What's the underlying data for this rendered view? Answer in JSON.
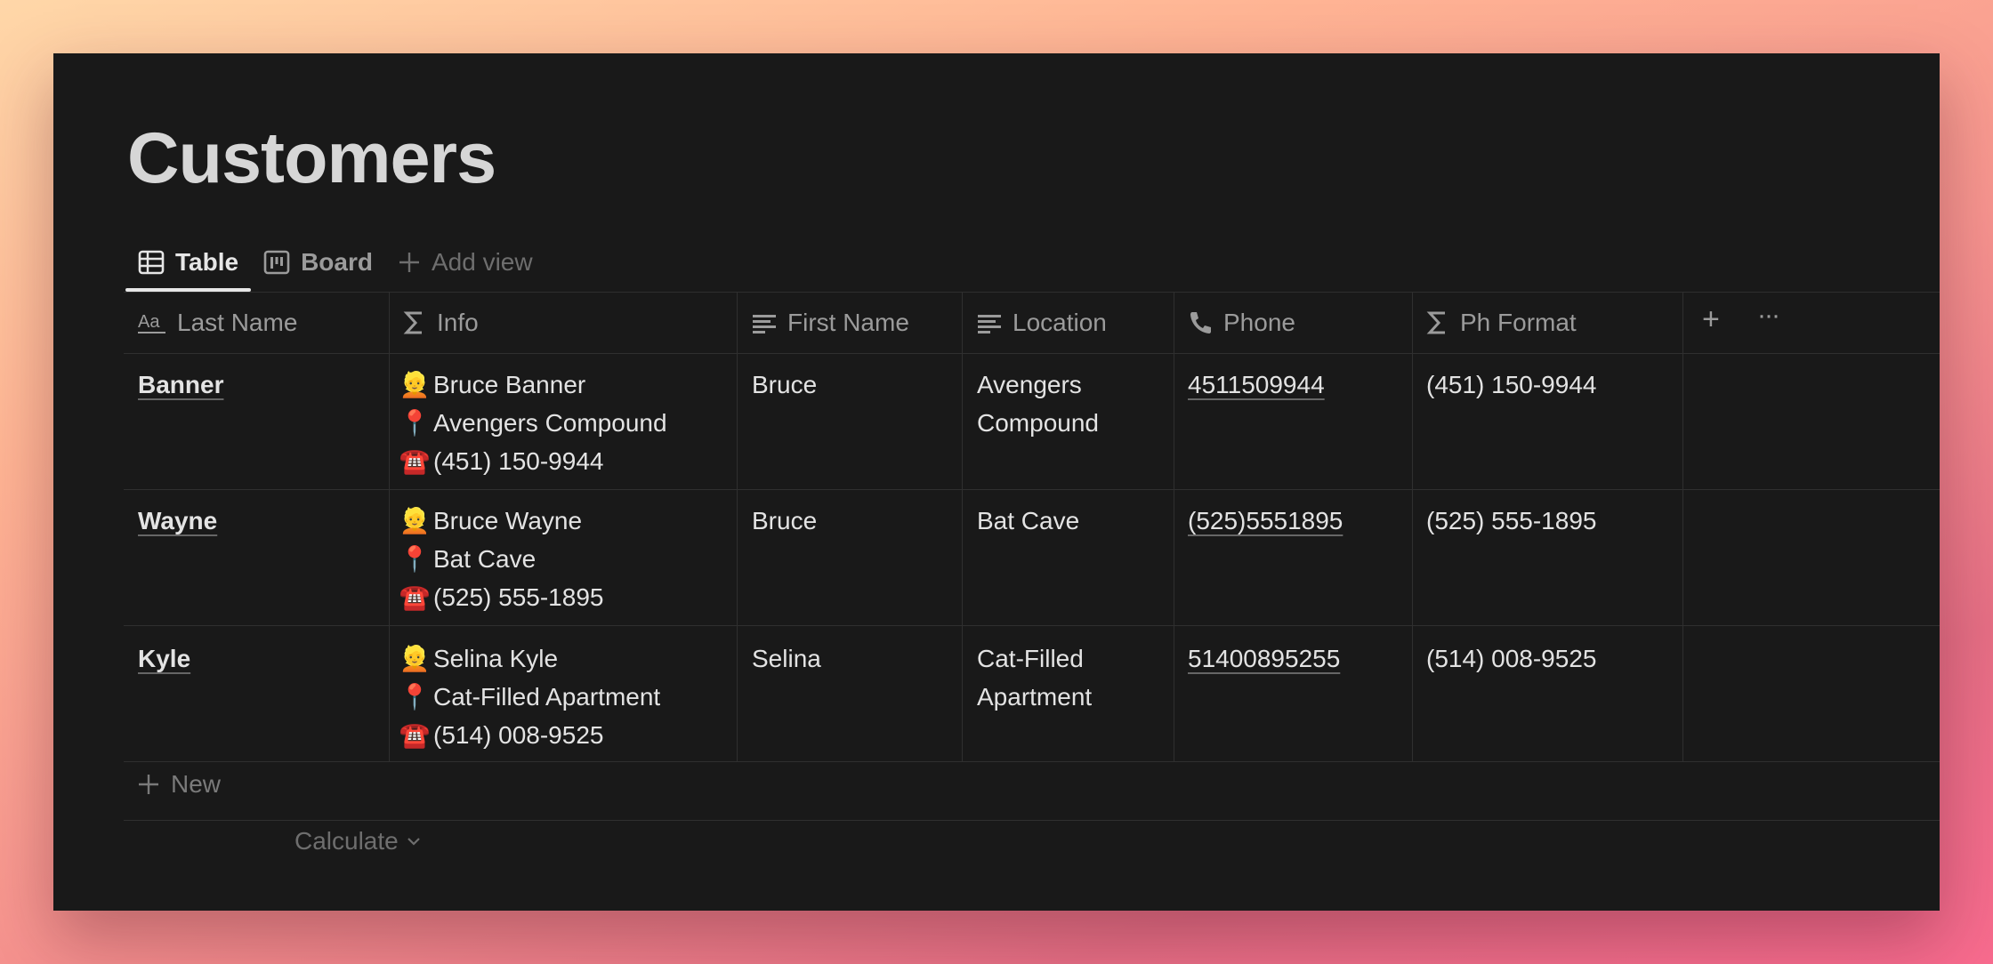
{
  "page": {
    "title": "Customers"
  },
  "views": {
    "tabs": [
      {
        "label": "Table",
        "icon": "table-icon"
      },
      {
        "label": "Board",
        "icon": "board-icon"
      }
    ],
    "add_view_label": "Add view"
  },
  "table": {
    "columns": [
      {
        "label": "Last Name",
        "icon": "title-text-icon"
      },
      {
        "label": "Info",
        "icon": "sigma-formula-icon"
      },
      {
        "label": "First Name",
        "icon": "text-lines-icon"
      },
      {
        "label": "Location",
        "icon": "text-lines-icon"
      },
      {
        "label": "Phone",
        "icon": "phone-icon"
      },
      {
        "label": "Ph Format",
        "icon": "sigma-formula-icon"
      }
    ],
    "add_column_label": "+",
    "more_label": "···",
    "rows": [
      {
        "last_name": "Banner",
        "info": {
          "name": "Bruce Banner",
          "place": "Avengers Compound",
          "phone": "(451) 150-9944"
        },
        "first_name": "Bruce",
        "location_1": "Avengers",
        "location_2": "Compound",
        "phone": "4511509944",
        "ph_format": "(451) 150-9944"
      },
      {
        "last_name": "Wayne",
        "info": {
          "name": "Bruce Wayne",
          "place": "Bat Cave",
          "phone": "(525) 555-1895"
        },
        "first_name": "Bruce",
        "location_1": "Bat Cave",
        "location_2": "",
        "phone": "(525)5551895",
        "ph_format": "(525) 555-1895"
      },
      {
        "last_name": "Kyle",
        "info": {
          "name": "Selina Kyle",
          "place": "Cat-Filled Apartment",
          "phone": "(514) 008-9525"
        },
        "first_name": "Selina",
        "location_1": "Cat-Filled",
        "location_2": "Apartment",
        "phone": "51400895255",
        "ph_format": "(514) 008-9525"
      }
    ],
    "new_label": "New",
    "calculate_label": "Calculate",
    "info_emojis": {
      "person": "👱",
      "pin": "📍",
      "phone": "☎️"
    }
  }
}
